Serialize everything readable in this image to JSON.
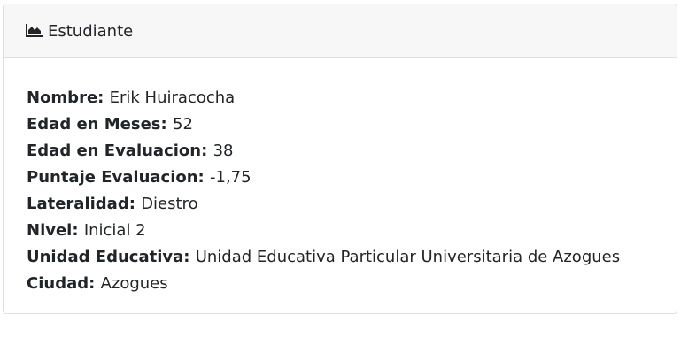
{
  "header": {
    "icon": "area-chart-icon",
    "title": "Estudiante"
  },
  "details": [
    {
      "label": "Nombre:",
      "value": "Erik Huiracocha"
    },
    {
      "label": "Edad en Meses:",
      "value": "52"
    },
    {
      "label": "Edad en Evaluacion:",
      "value": "38"
    },
    {
      "label": "Puntaje Evaluacion:",
      "value": "-1,75"
    },
    {
      "label": "Lateralidad:",
      "value": "Diestro"
    },
    {
      "label": "Nivel:",
      "value": "Inicial 2"
    },
    {
      "label": "Unidad Educativa:",
      "value": "Unidad Educativa Particular Universitaria de Azogues"
    },
    {
      "label": "Ciudad:",
      "value": "Azogues"
    }
  ]
}
